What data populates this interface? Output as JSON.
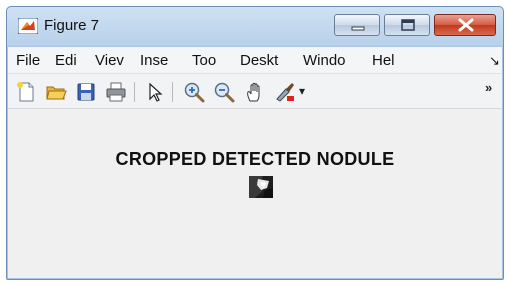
{
  "window": {
    "title": "Figure 7"
  },
  "menubar": {
    "items": [
      "File",
      "Edi",
      "Viev",
      "Inse",
      "Too",
      "Deskt",
      "Windo",
      "Hel"
    ],
    "overflow_icon": "menu-overflow-arrow"
  },
  "toolbar": {
    "icons": [
      "new-figure",
      "open-file",
      "save",
      "print",
      "pointer",
      "zoom-in",
      "zoom-out",
      "pan",
      "data-cursor",
      "more"
    ],
    "more_label": "»",
    "dropdown_label": "▾"
  },
  "figure": {
    "title": "CROPPED DETECTED NODULE"
  }
}
